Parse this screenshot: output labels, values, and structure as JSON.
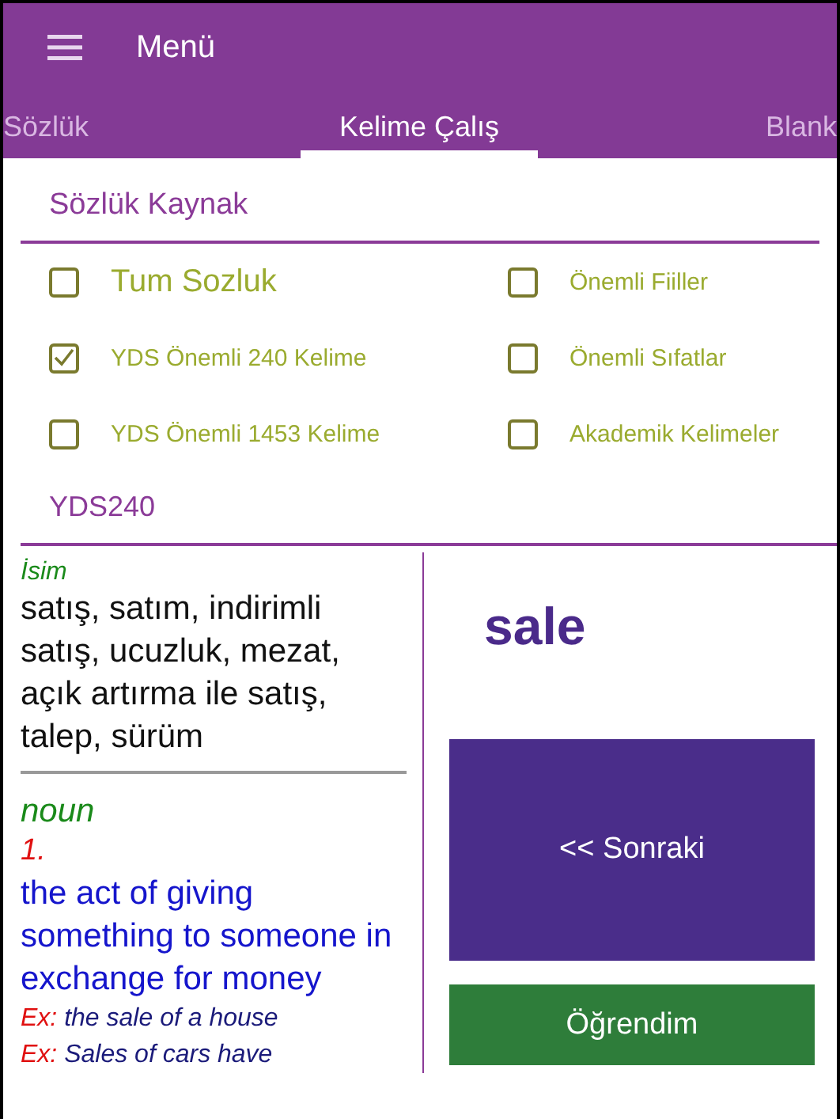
{
  "app_bar": {
    "title": "Menü"
  },
  "tabs": [
    {
      "label": "Sözlük",
      "selected": false
    },
    {
      "label": "Kelime Çalış",
      "selected": true
    },
    {
      "label": "Blank",
      "selected": false
    }
  ],
  "source": {
    "heading": "Sözlük Kaynak",
    "options": [
      {
        "label": "Tum Sozluk",
        "checked": false
      },
      {
        "label": "Önemli Fiiller",
        "checked": false
      },
      {
        "label": "YDS Önemli 240 Kelime",
        "checked": true
      },
      {
        "label": "Önemli Sıfatlar",
        "checked": false
      },
      {
        "label": "YDS Önemli 1453 Kelime",
        "checked": false
      },
      {
        "label": "Akademik Kelimeler",
        "checked": false
      }
    ],
    "current": "YDS240"
  },
  "meaning": {
    "turkish_pos": "İsim",
    "turkish": "satış, satım, indirimli satış, ucuzluk, mezat, açık artırma ile satış, talep, sürüm",
    "english_pos": "noun",
    "number": "1.",
    "definition": "the act of giving something to someone in exchange for money",
    "examples": [
      {
        "label": "Ex:",
        "text": "the sale of a house"
      },
      {
        "label": "Ex:",
        "text": "Sales of cars have"
      }
    ]
  },
  "word": "sale",
  "buttons": {
    "next": "<< Sonraki",
    "learned": "Öğrendim"
  }
}
